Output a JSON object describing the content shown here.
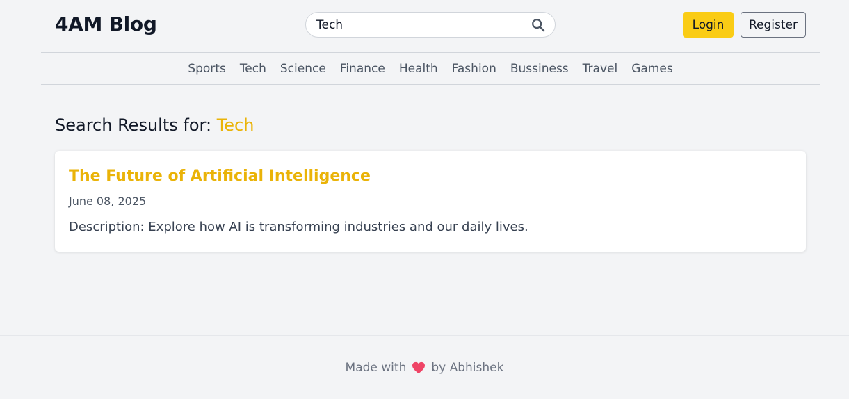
{
  "header": {
    "logo": "4AM Blog",
    "search": {
      "value": "Tech",
      "placeholder": ""
    },
    "login_label": "Login",
    "register_label": "Register"
  },
  "nav": {
    "items": [
      "Sports",
      "Tech",
      "Science",
      "Finance",
      "Health",
      "Fashion",
      "Bussiness",
      "Travel",
      "Games"
    ]
  },
  "main": {
    "heading_prefix": "Search Results for:",
    "query": "Tech",
    "results": [
      {
        "title": "The Future of Artificial Intelligence",
        "date": "June 08, 2025",
        "description": "Description: Explore how AI is transforming industries and our daily lives."
      }
    ]
  },
  "footer": {
    "made_with": "Made with",
    "by": "by Abhishek",
    "heart_icon": "heart-icon"
  },
  "colors": {
    "accent": "#facc15",
    "link": "#eab308",
    "background": "#f3f4f6",
    "heart": "#ef4466"
  }
}
